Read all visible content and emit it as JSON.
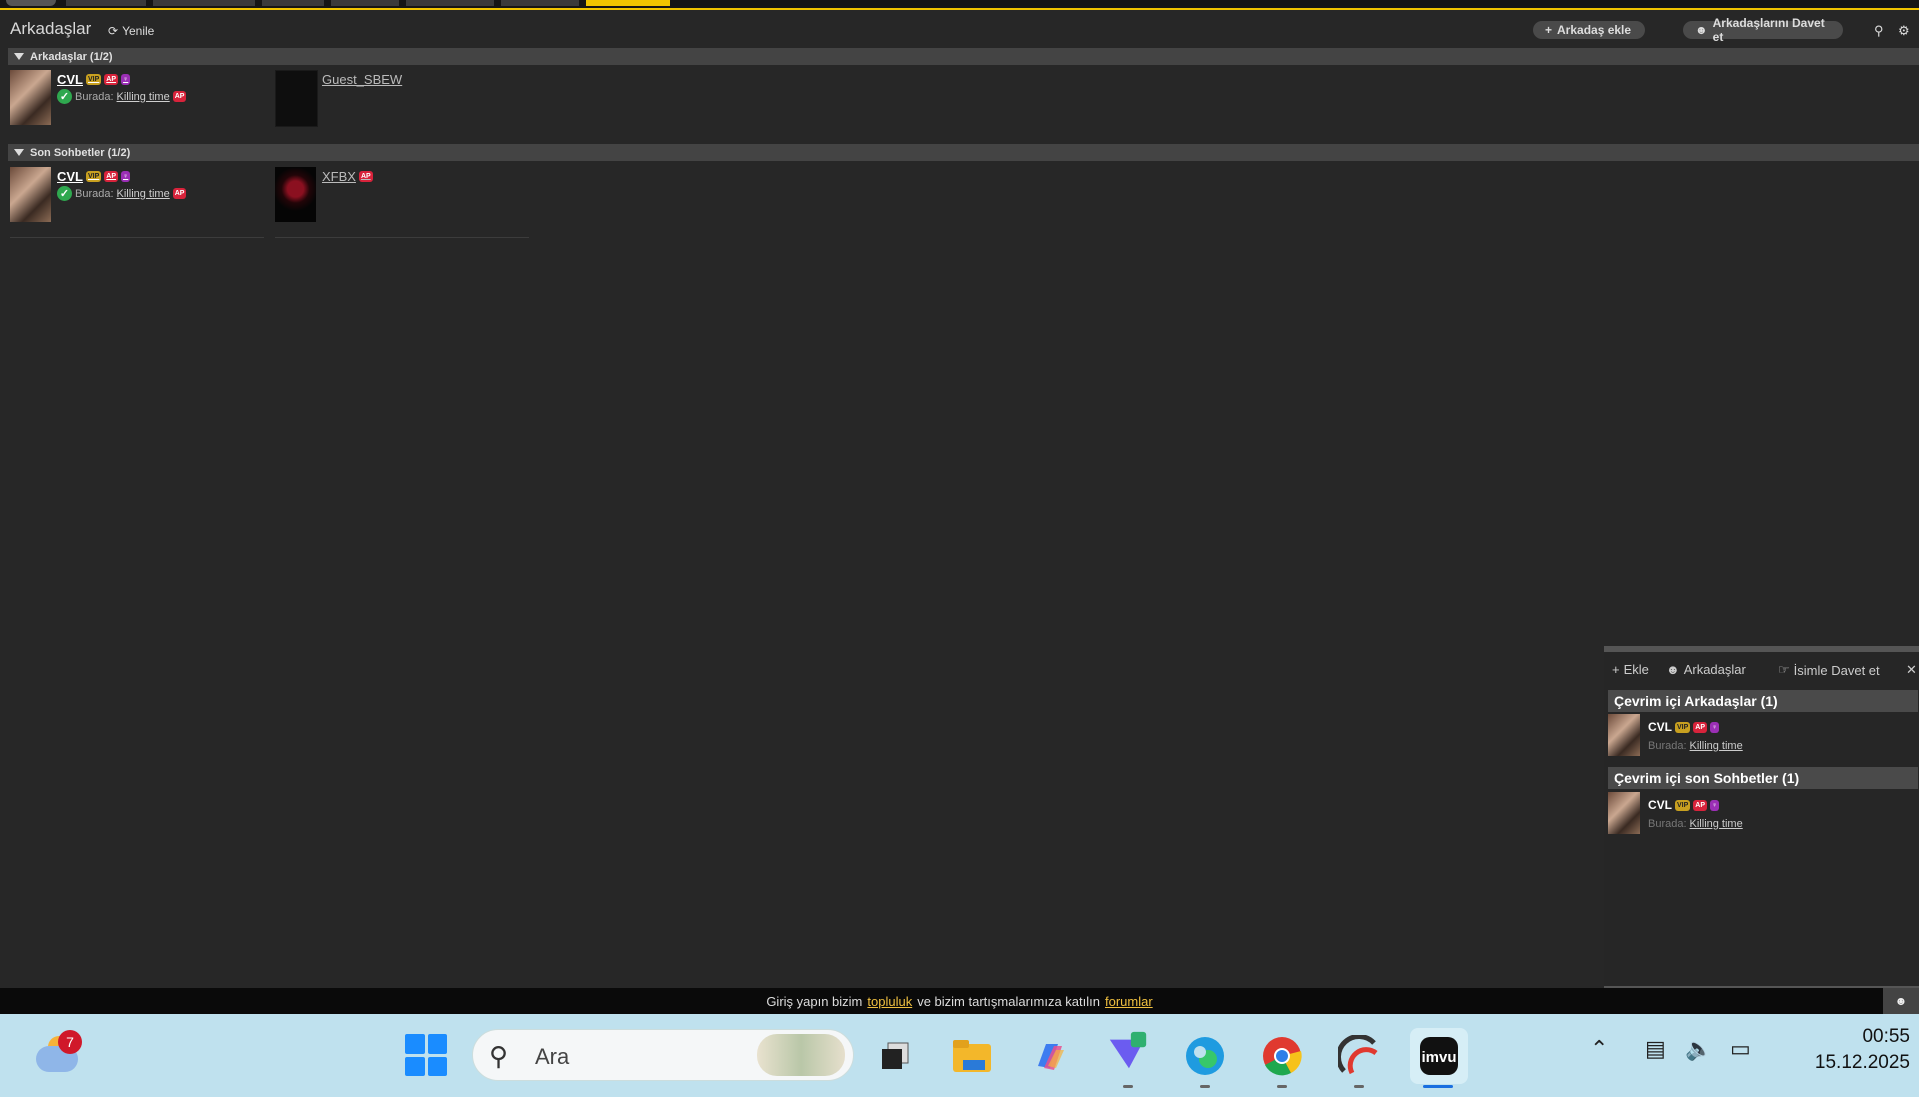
{
  "header": {
    "title": "Arkadaşlar",
    "refresh_label": "Yenile",
    "add_friend_label": "Arkadaş ekle",
    "invite_label": "Arkadaşlarını Davet et"
  },
  "sections": {
    "friends_title": "Arkadaşlar (1/2)",
    "recent_title": "Son Sohbetler (1/2)"
  },
  "friends": [
    {
      "name": "CVL",
      "badges": [
        "VIP",
        "AP",
        "XX"
      ],
      "status_prefix": "Burada:",
      "status_link": "Killing time"
    },
    {
      "name": "Guest_SBEW"
    }
  ],
  "recent": [
    {
      "name": "CVL",
      "badges": [
        "VIP",
        "AP",
        "XX"
      ],
      "status_prefix": "Burada:",
      "status_link": "Killing time"
    },
    {
      "name": "XFBX",
      "badges": [
        "AP"
      ]
    }
  ],
  "badge_labels": {
    "vip": "VIP",
    "ap": "AP",
    "xx": "♀"
  },
  "right_panel": {
    "tab_add": "Ekle",
    "tab_friends": "Arkadaşlar",
    "tab_invite": "İsimle Davet et",
    "online_friends_title": "Çevrim içi Arkadaşlar (1)",
    "online_recent_title": "Çevrim içi son Sohbetler (1)",
    "item_name": "CVL",
    "item_status_prefix": "Burada:",
    "item_status_link": "Killing time"
  },
  "infobar": {
    "pre": "Giriş yapın bizim",
    "link1": "topluluk",
    "mid": "ve bizim tartışmalarımıza katılın",
    "link2": "forumlar"
  },
  "taskbar": {
    "weather_count": "7",
    "search_placeholder": "Ara",
    "time": "00:55",
    "date": "15.12.2025"
  },
  "colors": {
    "accent": "#f0c400",
    "online": "#2fa84f",
    "ap_badge": "#d8233b",
    "vip_badge": "#c8a020"
  }
}
